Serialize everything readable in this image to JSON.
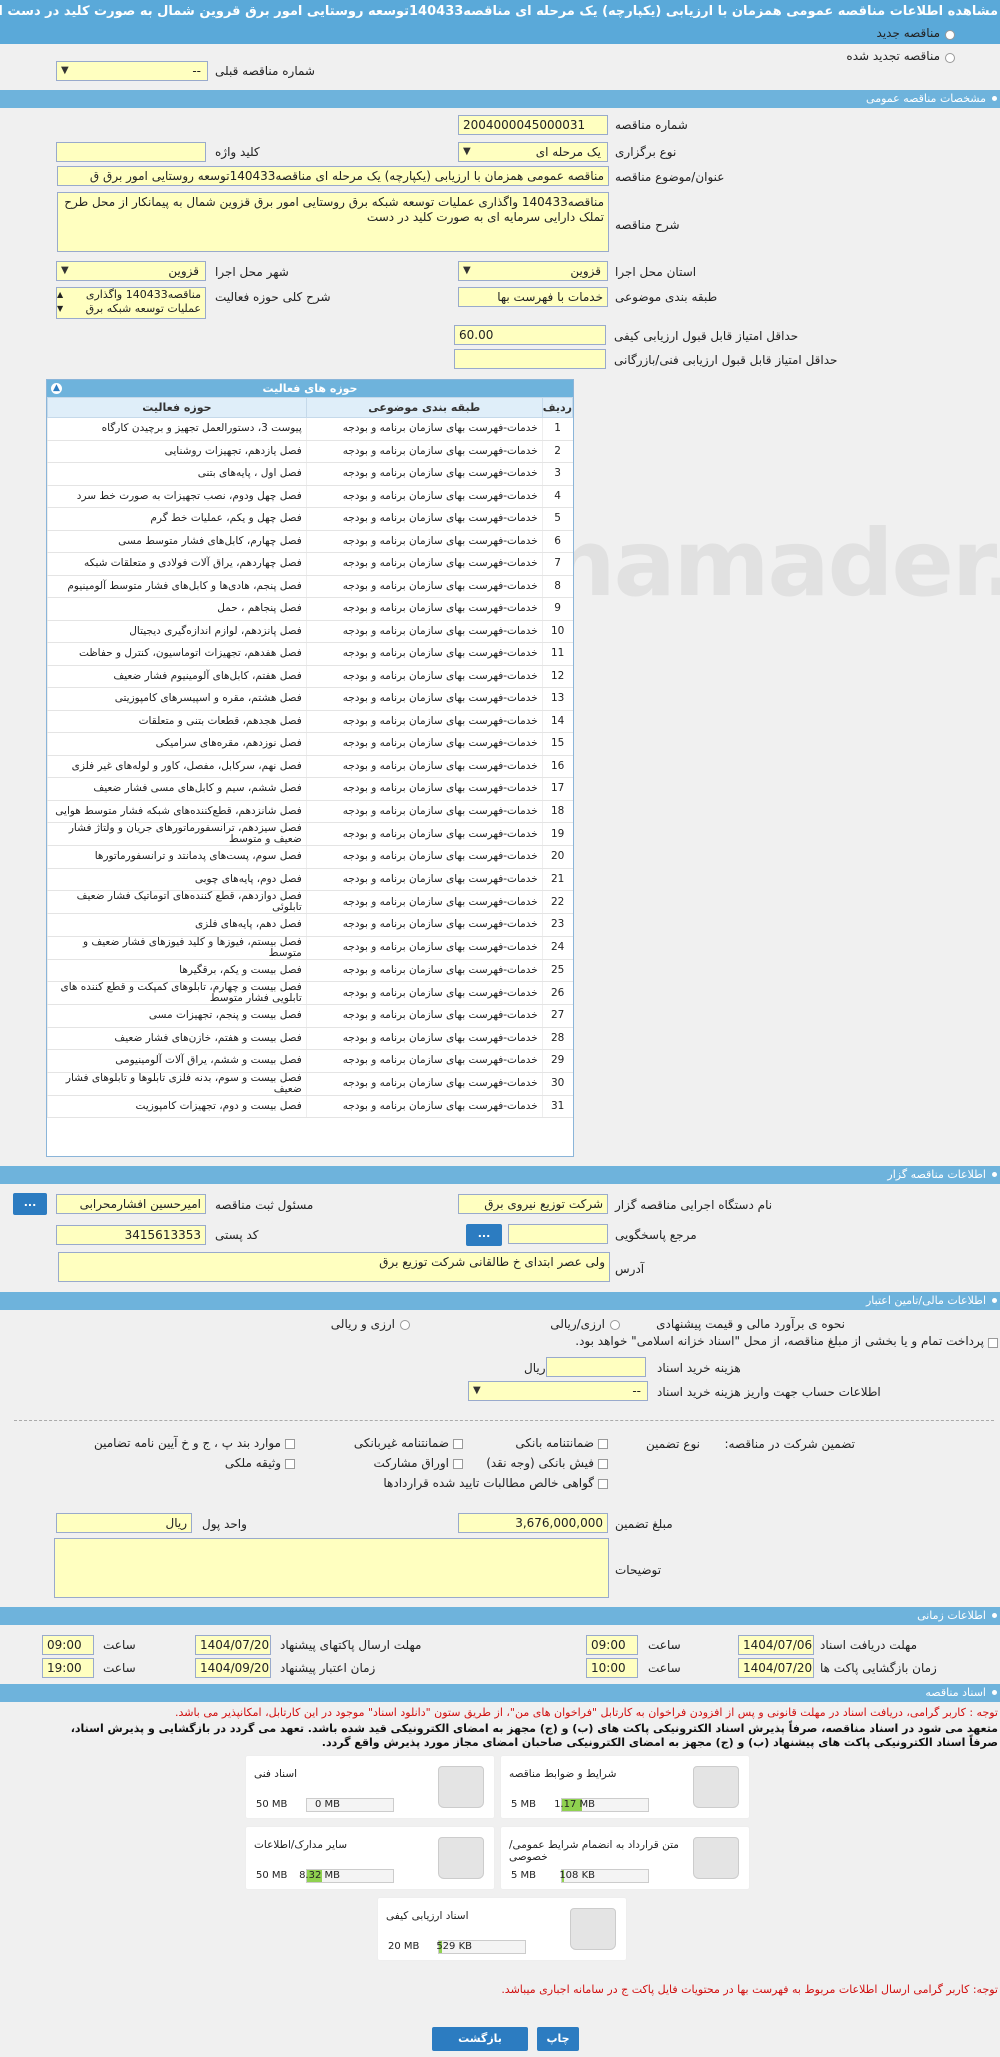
{
  "page_title": "مشاهده اطلاعات مناقصه عمومی همزمان با ارزیابی (یکپارچه) یک مرحله ای مناقصه140433توسعه روستایی امور برق قروین شمال به صورت کلید در دست از محل طرح تملک",
  "radio": {
    "new": "مناقصه جدید",
    "renewed": "مناقصه تجدید شده"
  },
  "prev_tender": {
    "label": "شماره مناقصه قبلی",
    "value": "--"
  },
  "sections": {
    "general": "مشخصات مناقصه عمومی",
    "organizer": "اطلاعات مناقصه گزار",
    "financial": "اطلاعات مالی/تامین اعتبار",
    "time": "اطلاعات زمانی",
    "documents": "اسناد مناقصه"
  },
  "general": {
    "number_label": "شماره مناقصه",
    "number": "2004000045000031",
    "type_label": "نوع برگزاری",
    "type": "یک مرحله ای",
    "keyword_label": "کلید واژه",
    "keyword": "",
    "subject_label": "عنوان/موضوع مناقصه",
    "subject": "مناقصه عمومی همزمان با ارزیابی (یکپارچه) یک مرحله ای مناقصه140433توسعه روستایی امور برق ق",
    "desc_label": "شرح مناقصه",
    "desc": "مناقصه140433 واگذاری عملیات توسعه شبکه برق روستایی امور برق قزوین شمال به پیمانکار از محل طرح تملک دارایی سرمایه ای به صورت کلید در دست",
    "province_label": "استان محل اجرا",
    "province": "قزوین",
    "city_label": "شهر محل اجرا",
    "city": "قزوین",
    "category_label": "طبقه بندی موضوعی",
    "category": "خدمات با فهرست بها",
    "activity_label": "شرح کلی حوزه فعالیت",
    "activity": "مناقصه140433 واگذاری عملیات توسعه شبکه برق",
    "min_quality_label": "حداقل امتیاز قابل قبول ارزیابی کیفی",
    "min_quality": "60.00",
    "min_tech_label": "حداقل امتیاز قابل قبول ارزیابی فنی/بازرگانی",
    "min_tech": ""
  },
  "activity_grid": {
    "title": "حوزه های فعالیت",
    "columns": [
      "ردیف",
      "طبقه بندی موضوعی",
      "حوزه فعالیت"
    ],
    "rows": [
      [
        "1",
        "خدمات-فهرست بهای سازمان برنامه و بودجه",
        "پیوست 3، دستورالعمل تجهیز و برچیدن کارگاه"
      ],
      [
        "2",
        "خدمات-فهرست بهای سازمان برنامه و بودجه",
        "فصل یازدهم، تجهیزات روشنایی"
      ],
      [
        "3",
        "خدمات-فهرست بهای سازمان برنامه و بودجه",
        "فصل اول ، پایه‌های بتنی"
      ],
      [
        "4",
        "خدمات-فهرست بهای سازمان برنامه و بودجه",
        "فصل چهل ودوم، نصب تجهیزات به صورت خط سرد"
      ],
      [
        "5",
        "خدمات-فهرست بهای سازمان برنامه و بودجه",
        "فصل چهل و یکم، عملیات خط گرم"
      ],
      [
        "6",
        "خدمات-فهرست بهای سازمان برنامه و بودجه",
        "فصل چهارم، کابل‌های فشار متوسط مسی"
      ],
      [
        "7",
        "خدمات-فهرست بهای سازمان برنامه و بودجه",
        "فصل چهاردهم، یراق آلات فولادی و متعلقات شبکه"
      ],
      [
        "8",
        "خدمات-فهرست بهای سازمان برنامه و بودجه",
        "فصل پنجم، هادی‌ها و کابل‌های فشار متوسط آلومینیوم"
      ],
      [
        "9",
        "خدمات-فهرست بهای سازمان برنامه و بودجه",
        "فصل پنجاهم ، حمل"
      ],
      [
        "10",
        "خدمات-فهرست بهای سازمان برنامه و بودجه",
        "فصل پانزدهم، لوازم اندازه‌گیری دیجیتال"
      ],
      [
        "11",
        "خدمات-فهرست بهای سازمان برنامه و بودجه",
        "فصل هفدهم، تجهیزات اتوماسیون، کنترل و حفاظت"
      ],
      [
        "12",
        "خدمات-فهرست بهای سازمان برنامه و بودجه",
        "فصل هفتم، کابل‌های آلومینیوم فشار ضعیف"
      ],
      [
        "13",
        "خدمات-فهرست بهای سازمان برنامه و بودجه",
        "فصل هشتم، مقره و اسپیسرهای کامپوزیتی"
      ],
      [
        "14",
        "خدمات-فهرست بهای سازمان برنامه و بودجه",
        "فصل هجدهم، قطعات بتنی و متعلقات"
      ],
      [
        "15",
        "خدمات-فهرست بهای سازمان برنامه و بودجه",
        "فصل نوزدهم، مقره‌های سرامیکی"
      ],
      [
        "16",
        "خدمات-فهرست بهای سازمان برنامه و بودجه",
        "فصل نهم، سرکابل، مفصل، کاور و لوله‌های غیر فلزی"
      ],
      [
        "17",
        "خدمات-فهرست بهای سازمان برنامه و بودجه",
        "فصل ششم، سیم و کابل‌های مسی فشار ضعیف"
      ],
      [
        "18",
        "خدمات-فهرست بهای سازمان برنامه و بودجه",
        "فصل شانزدهم، قطع‌کننده‌های شبکه فشار متوسط هوایی"
      ],
      [
        "19",
        "خدمات-فهرست بهای سازمان برنامه و بودجه",
        "فصل سیزدهم، ترانسفورماتورهای جریان و ولتاژ فشار ضعیف و متوسط"
      ],
      [
        "20",
        "خدمات-فهرست بهای سازمان برنامه و بودجه",
        "فصل سوم، پست‌های پدمانتد و ترانسفورماتورها"
      ],
      [
        "21",
        "خدمات-فهرست بهای سازمان برنامه و بودجه",
        "فصل دوم، پایه‌های چوبی"
      ],
      [
        "22",
        "خدمات-فهرست بهای سازمان برنامه و بودجه",
        "فصل دوازدهم، قطع کننده‌های اتوماتیک فشار ضعیف تابلوئی"
      ],
      [
        "23",
        "خدمات-فهرست بهای سازمان برنامه و بودجه",
        "فصل دهم، پایه‌های فلزی"
      ],
      [
        "24",
        "خدمات-فهرست بهای سازمان برنامه و بودجه",
        "فصل بیستم، فیوزها و کلید فیوزهای فشار ضعیف و متوسط"
      ],
      [
        "25",
        "خدمات-فهرست بهای سازمان برنامه و بودجه",
        "فصل بیست و یکم، برقگیرها"
      ],
      [
        "26",
        "خدمات-فهرست بهای سازمان برنامه و بودجه",
        "فصل بیست و چهارم، تابلوهای کمپکت و قطع کننده های تابلویی فشار متوسط"
      ],
      [
        "27",
        "خدمات-فهرست بهای سازمان برنامه و بودجه",
        "فصل بیست و پنجم، تجهیزات مسی"
      ],
      [
        "28",
        "خدمات-فهرست بهای سازمان برنامه و بودجه",
        "فصل بیست و هفتم، خازن‌های فشار ضعیف"
      ],
      [
        "29",
        "خدمات-فهرست بهای سازمان برنامه و بودجه",
        "فصل بیست و ششم، یراق آلات آلومینیومی"
      ],
      [
        "30",
        "خدمات-فهرست بهای سازمان برنامه و بودجه",
        "فصل بیست و سوم، بدنه فلزی تابلوها و تابلوهای فشار ضعیف"
      ],
      [
        "31",
        "خدمات-فهرست بهای سازمان برنامه و بودجه",
        "فصل بیست و دوم، تجهیزات کامپوزیت"
      ]
    ]
  },
  "organizer": {
    "device_label": "نام دستگاه اجرایی مناقصه گزار",
    "device": "شرکت توزیع نیروی برق",
    "responsible_label": "مسئول ثبت مناقصه",
    "responsible": "امیرحسین افشارمحرابی",
    "reference_label": "مرجع پاسخگویی",
    "reference": "",
    "postal_label": "کد پستی",
    "postal": "3415613353",
    "address_label": "آدرس",
    "address": "ولی عصر ابتدای خ طالقانی شرکت توزیع برق",
    "dots": "..."
  },
  "financial": {
    "estimate_label": "نحوه ی برآورد مالی و قیمت پیشنهادی",
    "opt_rial": "ارزی/ریالی",
    "opt_foreign": "ارزی و ریالی",
    "pay_text": "پرداخت تمام و یا بخشی از مبلغ مناقصه، از محل \"اسناد خزانه اسلامی\" خواهد بود.",
    "doc_cost_label": "هزینه خرید اسناد",
    "doc_cost": "",
    "doc_cost_unit": "ریال",
    "account_label": "اطلاعات حساب جهت واریز هزینه خرید اسناد",
    "account": "--"
  },
  "guarantee": {
    "label": "تضمین شرکت در مناقصه:",
    "type_label": "نوع تضمین",
    "opts": [
      "ضمانتنامه بانکی",
      "ضمانتنامه غیربانکی",
      "موارد بند پ ، ج و خ آیین نامه تضامین",
      "فیش بانکی (وجه نقد)",
      "اوراق مشارکت",
      "وثیقه ملکی",
      "گواهی خالص مطالبات تایید شده قراردادها"
    ],
    "amount_label": "مبلغ تضمین",
    "amount": "3,676,000,000",
    "currency_label": "واحد پول",
    "currency": "ریال",
    "notes_label": "توضیحات",
    "notes": ""
  },
  "time": {
    "doc_receive_label": "مهلت دریافت اسناد",
    "doc_receive_date": "1404/07/06",
    "doc_receive_time": "09:00",
    "send_label": "مهلت ارسال پاکتهای پیشنهاد",
    "send_date": "1404/07/20",
    "send_time": "09:00",
    "open_label": "زمان بازگشایی پاکت ها",
    "open_date": "1404/07/20",
    "open_time": "10:00",
    "valid_label": "زمان اعتبار پیشنهاد",
    "valid_date": "1404/09/20",
    "valid_time": "19:00",
    "time_word": "ساعت"
  },
  "docs_notes": {
    "note1": "توجه : کاربر گرامی، دریافت اسناد در مهلت قانونی و پس از افزودن فراخوان به کارتابل \"فراخوان های من\"، از طریق ستون \"دانلود اسناد\" موجود در این کارتابل، امکانپذیر می باشد.",
    "note2": "متعهد می شود در اسناد مناقصه، صرفاً پذیرش اسناد الکترونیکی پاکت های (ب) و (ج) مجهز به امضای الکترونیکی قید شده باشد. تعهد می گردد در بازگشایی و پذیرش اسناد،",
    "note3": "صرفاً اسناد الکترونیکی پاکت های پیشنهاد (ب) و (ج) مجهز به امضای الکترونیکی صاحبان امضای مجاز مورد پذیرش واقع گردد.",
    "note4": "توجه: کاربر گرامی ارسال اطلاعات مربوط به فهرست بها در محتویات فایل پاکت ج در سامانه اجباری میباشد."
  },
  "documents": [
    {
      "name": "شرایط و ضوابط مناقصه",
      "used": "1.17 MB",
      "max": "5 MB",
      "fill": 0.23
    },
    {
      "name": "اسناد فنی",
      "used": "0 MB",
      "max": "50 MB",
      "fill": 0.0
    },
    {
      "name": "متن قرارداد به انضمام شرایط عمومی/خصوصی",
      "used": "108 KB",
      "max": "5 MB",
      "fill": 0.02
    },
    {
      "name": "سایر مدارک/اطلاعات",
      "used": "8.32 MB",
      "max": "50 MB",
      "fill": 0.17
    },
    {
      "name": "اسناد ارزیابی کیفی",
      "used": "529 KB",
      "max": "20 MB",
      "fill": 0.03
    }
  ],
  "buttons": {
    "print": "چاپ",
    "back": "بازگشت"
  },
  "watermark": "parsnamader.net"
}
